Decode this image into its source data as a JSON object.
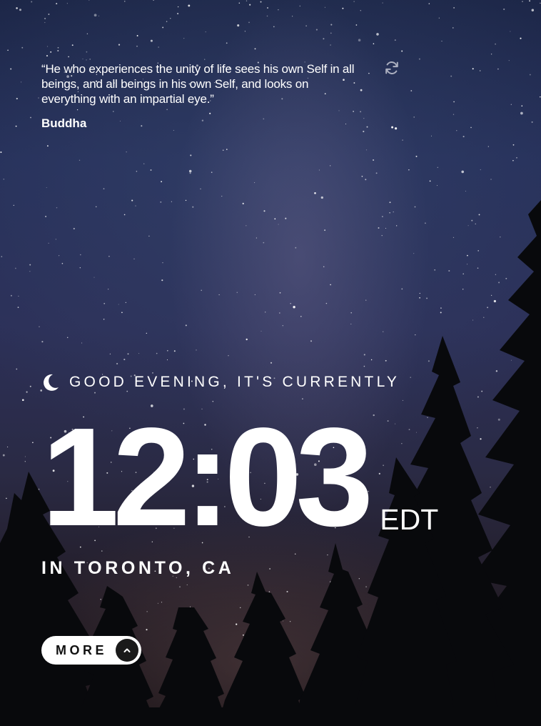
{
  "quote": {
    "text": "“He who experiences the unity of life sees his own Self in all beings, and all beings in his own Self, and looks on everything with an impartial eye.”",
    "author": "Buddha",
    "refresh_icon": "refresh-icon"
  },
  "greeting": {
    "icon": "moon-icon",
    "text": "GOOD EVENING, IT'S CURRENTLY"
  },
  "clock": {
    "time": "12:03",
    "timezone": "EDT"
  },
  "location": {
    "text": "IN TORONTO, CA"
  },
  "more_button": {
    "label": "MORE",
    "icon": "chevron-up-icon"
  },
  "colors": {
    "text": "#ffffff",
    "button_bg": "#ffffff",
    "button_text": "#111111",
    "chevron_bg": "#1a1a1a"
  }
}
